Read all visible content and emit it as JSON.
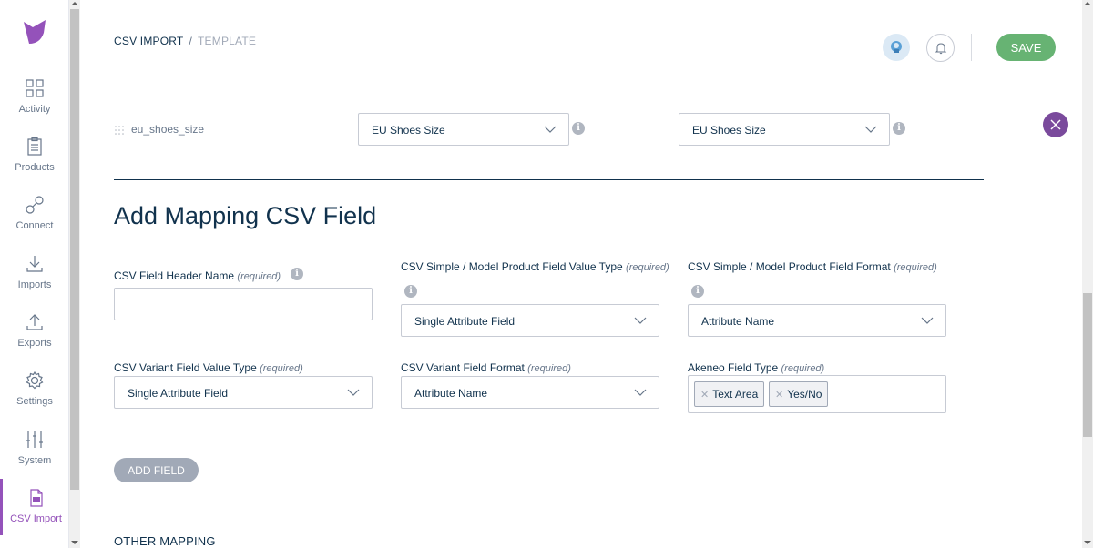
{
  "sidebar": {
    "items": [
      {
        "label": "Activity",
        "icon": "grid-icon"
      },
      {
        "label": "Products",
        "icon": "clipboard-icon"
      },
      {
        "label": "Connect",
        "icon": "connect-icon"
      },
      {
        "label": "Imports",
        "icon": "download-icon"
      },
      {
        "label": "Exports",
        "icon": "upload-icon"
      },
      {
        "label": "Settings",
        "icon": "gear-icon"
      },
      {
        "label": "System",
        "icon": "sliders-icon"
      },
      {
        "label": "CSV Import",
        "icon": "csv-file-icon"
      }
    ],
    "active": "CSV Import",
    "accent_color": "#9452ba"
  },
  "header": {
    "breadcrumb": [
      "CSV IMPORT",
      "/",
      "TEMPLATE"
    ],
    "save_label": "SAVE",
    "save_color": "#67b373"
  },
  "mapping_row": {
    "code": "eu_shoes_size",
    "select1": "EU Shoes Size",
    "select2": "EU Shoes Size"
  },
  "section": {
    "title": "Add Mapping CSV Field"
  },
  "form": {
    "header_name": {
      "label": "CSV Field Header Name",
      "required": "(required)",
      "value": ""
    },
    "simple_value_type": {
      "label": "CSV Simple / Model Product Field Value Type",
      "required": "(required)",
      "value": "Single Attribute Field"
    },
    "simple_format": {
      "label": "CSV Simple / Model Product Field Format",
      "required": "(required)",
      "value": "Attribute Name"
    },
    "variant_value_type": {
      "label": "CSV Variant Field Value Type",
      "required": "(required)",
      "value": "Single Attribute Field"
    },
    "variant_format": {
      "label": "CSV Variant Field Format",
      "required": "(required)",
      "value": "Attribute Name"
    },
    "akeneo_type": {
      "label": "Akeneo Field Type",
      "required": "(required)",
      "chips": [
        "Text Area",
        "Yes/No"
      ]
    }
  },
  "add_field_label": "ADD FIELD",
  "other_mapping_label": "OTHER MAPPING"
}
